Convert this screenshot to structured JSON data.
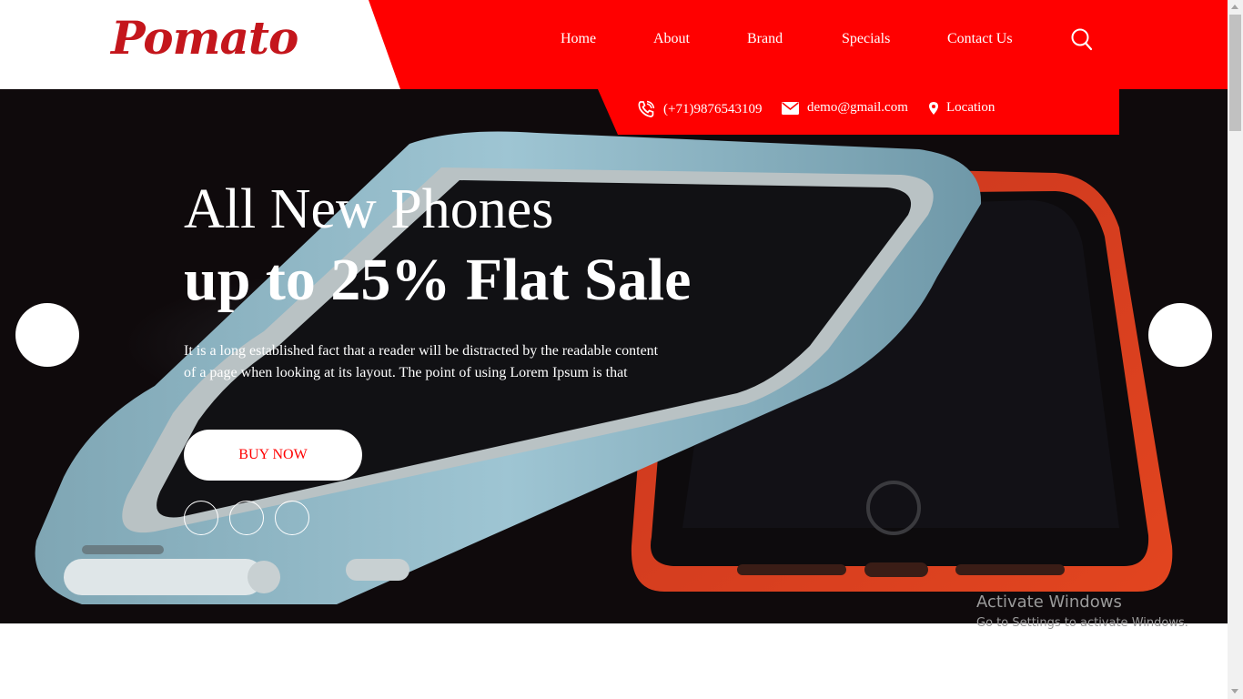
{
  "brand": {
    "logo": "Pomato"
  },
  "nav": {
    "items": [
      {
        "label": "Home"
      },
      {
        "label": "About"
      },
      {
        "label": "Brand"
      },
      {
        "label": "Specials"
      },
      {
        "label": "Contact Us"
      }
    ],
    "search_icon": "search-icon"
  },
  "contact": {
    "phone": "(+71)9876543109",
    "email": "demo@gmail.com",
    "location": "Location"
  },
  "hero": {
    "heading_line1": "All New Phones",
    "heading_line2": "up to 25% Flat Sale",
    "body_line1": "It is a long established fact that a reader will be distracted by the readable content",
    "body_line2": "of a page when looking at its layout. The point of using Lorem Ipsum is that",
    "button": "BUY NOW"
  },
  "watermark": {
    "title": "Activate Windows",
    "subtitle": "Go to Settings to activate Windows."
  },
  "colors": {
    "accent": "#ff0000",
    "logo": "#c4161c",
    "hero_background": "#0f0a0c"
  }
}
